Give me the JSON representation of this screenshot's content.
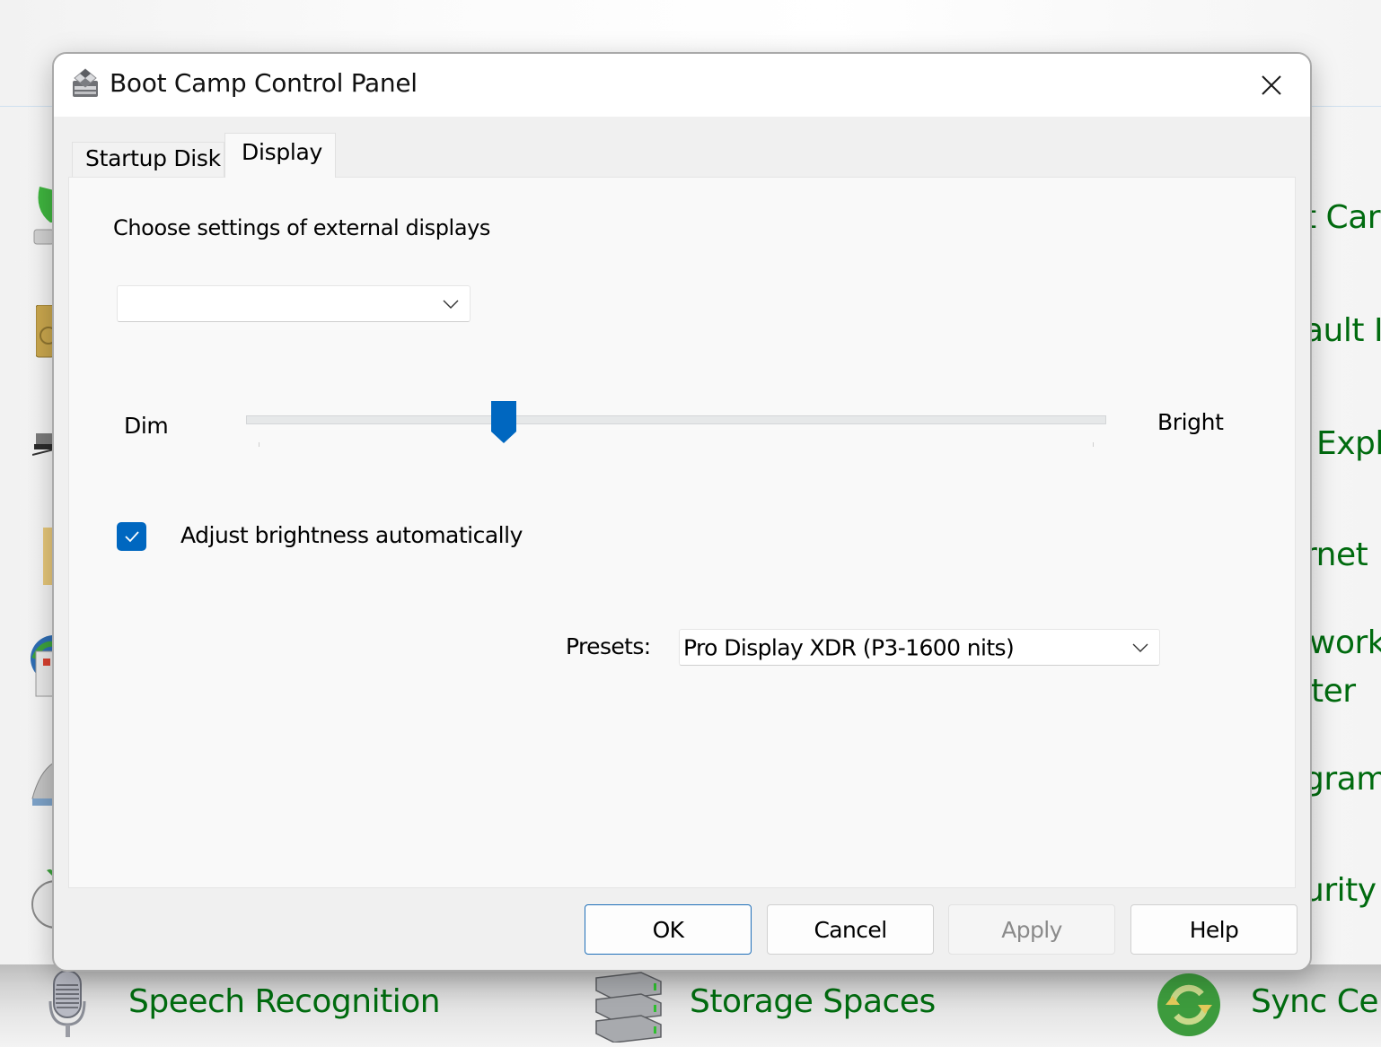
{
  "background": {
    "right_items": [
      {
        "text": "t Car",
        "name": "bg-item-boot-camp"
      },
      {
        "text": "ault I",
        "name": "bg-item-default-programs"
      },
      {
        "text": "Expl",
        "name": "bg-item-file-explorer"
      },
      {
        "text": "rnet",
        "name": "bg-item-internet-options"
      },
      {
        "text": "work",
        "name": "bg-item-network"
      },
      {
        "text": "ter",
        "name": "bg-item-network-center"
      },
      {
        "text": "gram",
        "name": "bg-item-programs"
      },
      {
        "text": "urity",
        "name": "bg-item-security"
      }
    ],
    "bottom_items": [
      {
        "text": "Speech Recognition",
        "icon": "microphone-icon"
      },
      {
        "text": "Storage Spaces",
        "icon": "storage-spaces-icon"
      },
      {
        "text": "Sync Cer",
        "icon": "sync-center-icon"
      }
    ],
    "accent_color": "#006b0f"
  },
  "dialog": {
    "title": "Boot Camp Control Panel",
    "app_icon": "boot-camp-icon",
    "close_icon": "close-icon",
    "tabs": [
      {
        "label": "Startup Disk",
        "active": false
      },
      {
        "label": "Display",
        "active": true
      }
    ],
    "display_tab": {
      "section_label": "Choose settings of external displays",
      "external_display_select": {
        "value": ""
      },
      "brightness": {
        "min_label": "Dim",
        "max_label": "Bright",
        "value_fraction": 0.3
      },
      "auto_brightness": {
        "label": "Adjust brightness automatically",
        "checked": true
      },
      "presets": {
        "label": "Presets:",
        "value": "Pro Display XDR (P3-1600 nits)"
      }
    },
    "buttons": {
      "ok": "OK",
      "cancel": "Cancel",
      "apply": "Apply",
      "help": "Help"
    },
    "accent_color": "#0067c0"
  }
}
